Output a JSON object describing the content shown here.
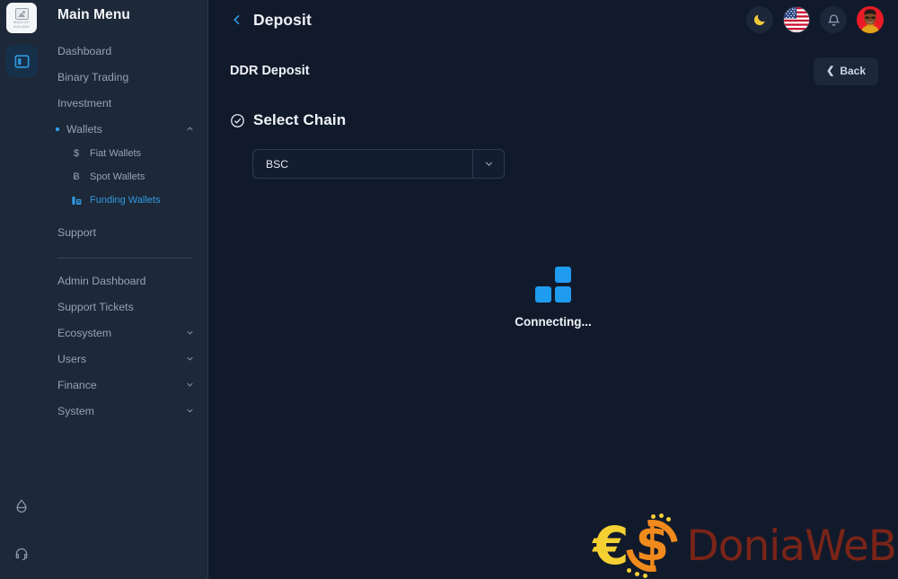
{
  "rail": {
    "logo_alt_line1": "IMAGE NOT",
    "logo_alt_line2": "AVAILABLE",
    "panel_toggle_name": "panel-toggle",
    "bottom_icons": [
      "contrast-droplet-icon",
      "headset-support-icon"
    ]
  },
  "sidebar": {
    "title": "Main Menu",
    "items": [
      {
        "label": "Dashboard",
        "type": "link"
      },
      {
        "label": "Binary Trading",
        "type": "link"
      },
      {
        "label": "Investment",
        "type": "link"
      },
      {
        "label": "Wallets",
        "type": "group",
        "expanded": true,
        "dot": true
      }
    ],
    "wallet_children": [
      {
        "label": "Fiat Wallets",
        "icon": "$",
        "active": false
      },
      {
        "label": "Spot Wallets",
        "icon": "Ƀ",
        "active": false
      },
      {
        "label": "Funding Wallets",
        "icon": "funding-wallet-icon",
        "active": true
      }
    ],
    "support_label": "Support",
    "admin_items": [
      {
        "label": "Admin Dashboard",
        "type": "link"
      },
      {
        "label": "Support Tickets",
        "type": "link"
      },
      {
        "label": "Ecosystem",
        "type": "group"
      },
      {
        "label": "Users",
        "type": "group"
      },
      {
        "label": "Finance",
        "type": "group"
      },
      {
        "label": "System",
        "type": "group"
      }
    ],
    "accent_color": "#2f9ae0",
    "bg_color": "#1d2838"
  },
  "topbar": {
    "title": "Deposit",
    "back_icon": "chevron-left-icon",
    "actions": [
      {
        "name": "dark-mode-toggle",
        "icon": "moon-icon"
      },
      {
        "name": "language-selector",
        "icon": "us-flag-icon"
      },
      {
        "name": "notifications-button",
        "icon": "bell-icon"
      },
      {
        "name": "user-avatar",
        "icon": "avatar-icon"
      }
    ]
  },
  "main": {
    "heading": "DDR Deposit",
    "back_button": "Back",
    "back_button_icon": "chevron-left-icon",
    "section": {
      "icon": "check-circle-icon",
      "title": "Select Chain"
    },
    "chain_select": {
      "value": "BSC",
      "placeholder": "BSC",
      "arrow_icon": "chevron-down-icon"
    },
    "status": {
      "text": "Connecting...",
      "spinner_icon": "blocks-loader-icon",
      "spinner_color": "#1f9cf0"
    }
  },
  "watermark": {
    "symbol_euro": "€",
    "symbol_dollar": "$",
    "name": "DoniaWeB",
    "euro_color": "#f5d033",
    "dollar_color": "#f08a1c",
    "name_color": "#7a2418"
  }
}
